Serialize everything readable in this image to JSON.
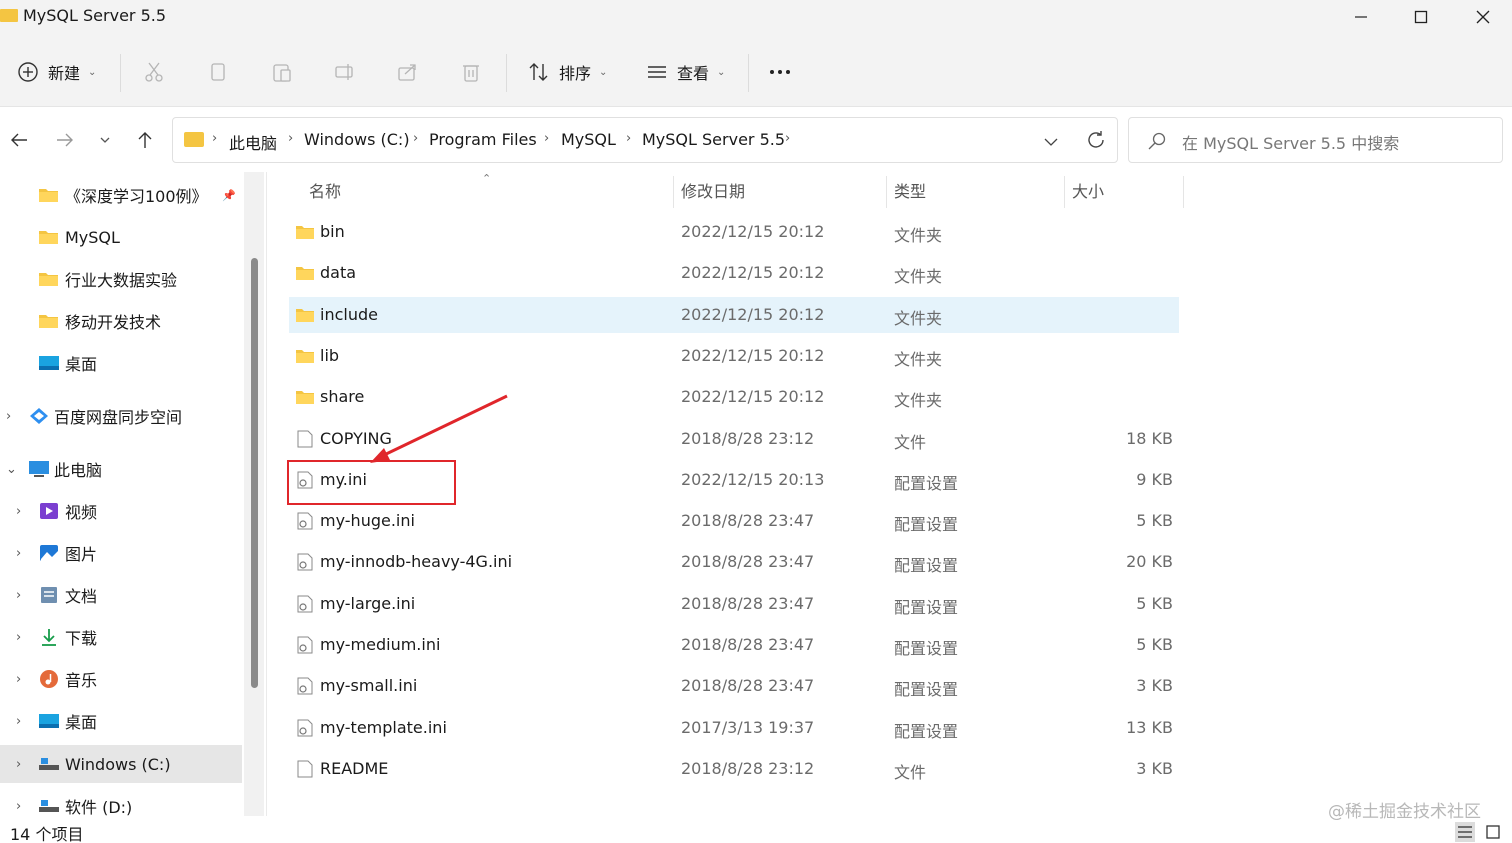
{
  "window": {
    "title": "MySQL Server 5.5",
    "minimize_icon": "minimize-icon",
    "maximize_icon": "maximize-icon",
    "close_icon": "close-icon"
  },
  "toolbar": {
    "new_label": "新建",
    "sort_label": "排序",
    "view_label": "查看",
    "more_icon": "ellipsis-icon",
    "icons": [
      "add-circle-icon",
      "cut-icon",
      "copy-icon",
      "paste-icon",
      "rename-icon",
      "share-icon",
      "delete-icon",
      "sort-icon",
      "view-icon"
    ]
  },
  "address": {
    "breadcrumbs": [
      "此电脑",
      "Windows (C:)",
      "Program Files",
      "MySQL",
      "MySQL Server 5.5"
    ],
    "search_placeholder": "在 MySQL Server 5.5 中搜索"
  },
  "sidebar": {
    "items": [
      {
        "label": "《深度学习100例》",
        "icon": "folder-icon",
        "pinned": true
      },
      {
        "label": "MySQL",
        "icon": "folder-icon"
      },
      {
        "label": "行业大数据实验",
        "icon": "folder-icon"
      },
      {
        "label": "移动开发技术",
        "icon": "folder-icon"
      },
      {
        "label": "桌面",
        "icon": "desktop-icon"
      },
      {
        "label": "百度网盘同步空间",
        "icon": "baidu-cloud-icon"
      },
      {
        "label": "此电脑",
        "icon": "computer-icon"
      },
      {
        "label": "视频",
        "icon": "video-icon"
      },
      {
        "label": "图片",
        "icon": "pictures-icon"
      },
      {
        "label": "文档",
        "icon": "documents-icon"
      },
      {
        "label": "下载",
        "icon": "download-icon"
      },
      {
        "label": "音乐",
        "icon": "music-icon"
      },
      {
        "label": "桌面",
        "icon": "desktop-icon"
      },
      {
        "label": "Windows (C:)",
        "icon": "drive-icon",
        "selected": true
      },
      {
        "label": "软件 (D:)",
        "icon": "drive-icon"
      }
    ]
  },
  "columns": {
    "name": "名称",
    "date": "修改日期",
    "type": "类型",
    "size": "大小"
  },
  "files": [
    {
      "name": "bin",
      "date": "2022/12/15 20:12",
      "type": "文件夹",
      "size": "",
      "kind": "folder"
    },
    {
      "name": "data",
      "date": "2022/12/15 20:12",
      "type": "文件夹",
      "size": "",
      "kind": "folder"
    },
    {
      "name": "include",
      "date": "2022/12/15 20:12",
      "type": "文件夹",
      "size": "",
      "kind": "folder",
      "hover": true
    },
    {
      "name": "lib",
      "date": "2022/12/15 20:12",
      "type": "文件夹",
      "size": "",
      "kind": "folder"
    },
    {
      "name": "share",
      "date": "2022/12/15 20:12",
      "type": "文件夹",
      "size": "",
      "kind": "folder"
    },
    {
      "name": "COPYING",
      "date": "2018/8/28 23:12",
      "type": "文件",
      "size": "18 KB",
      "kind": "file"
    },
    {
      "name": "my.ini",
      "date": "2022/12/15 20:13",
      "type": "配置设置",
      "size": "9 KB",
      "kind": "ini"
    },
    {
      "name": "my-huge.ini",
      "date": "2018/8/28 23:47",
      "type": "配置设置",
      "size": "5 KB",
      "kind": "ini"
    },
    {
      "name": "my-innodb-heavy-4G.ini",
      "date": "2018/8/28 23:47",
      "type": "配置设置",
      "size": "20 KB",
      "kind": "ini"
    },
    {
      "name": "my-large.ini",
      "date": "2018/8/28 23:47",
      "type": "配置设置",
      "size": "5 KB",
      "kind": "ini"
    },
    {
      "name": "my-medium.ini",
      "date": "2018/8/28 23:47",
      "type": "配置设置",
      "size": "5 KB",
      "kind": "ini"
    },
    {
      "name": "my-small.ini",
      "date": "2018/8/28 23:47",
      "type": "配置设置",
      "size": "3 KB",
      "kind": "ini"
    },
    {
      "name": "my-template.ini",
      "date": "2017/3/13 19:37",
      "type": "配置设置",
      "size": "13 KB",
      "kind": "ini"
    },
    {
      "name": "README",
      "date": "2018/8/28 23:12",
      "type": "文件",
      "size": "3 KB",
      "kind": "file"
    }
  ],
  "status": {
    "item_count": "14 个项目",
    "watermark": "@稀土掘金技术社区"
  },
  "colors": {
    "accent": "#0067c0",
    "hover_row": "#e5f3fb",
    "annotation_red": "#e0262b",
    "folder_yellow": "#f4c542"
  }
}
